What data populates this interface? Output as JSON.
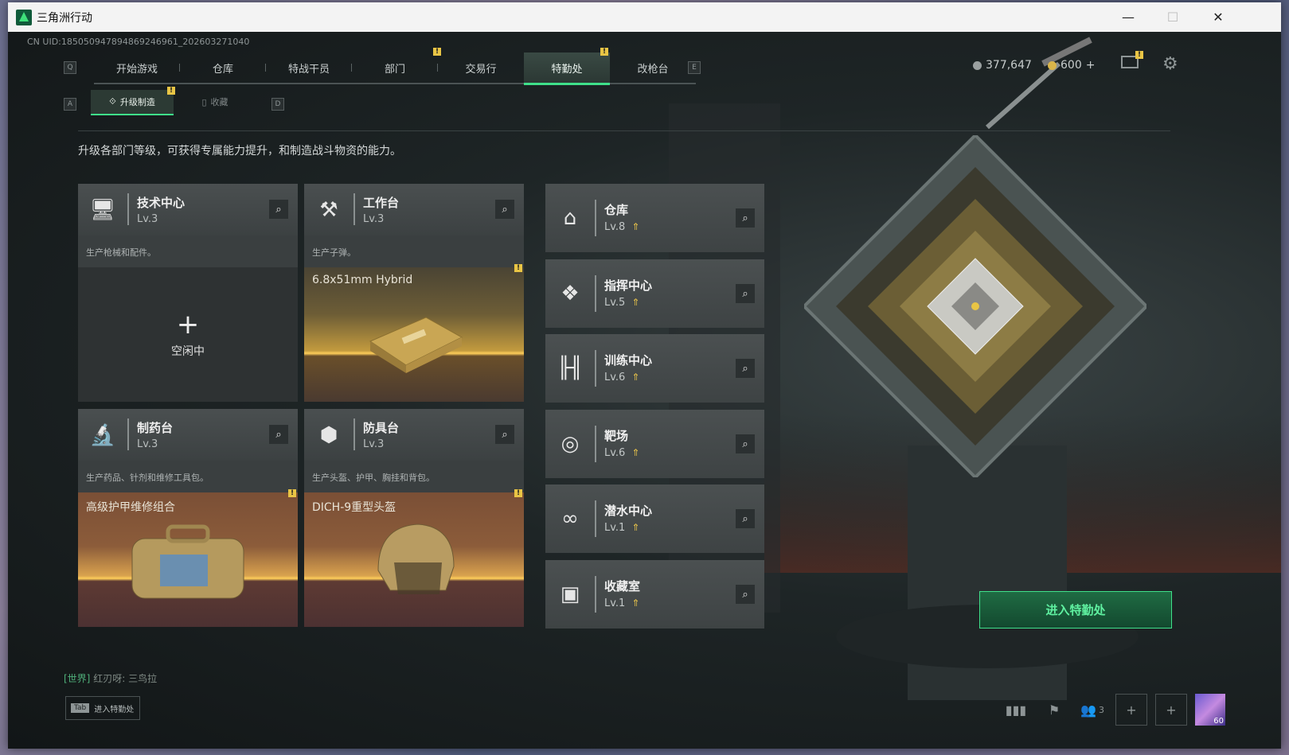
{
  "window": {
    "title": "三角洲行动",
    "minimize": "—",
    "maximize": "☐",
    "close": "✕"
  },
  "uid": "CN UID:1850509478948692469​61_202603271040",
  "nav": {
    "key_left": "Q",
    "key_right": "E",
    "tabs": [
      "开始游戏",
      "仓库",
      "特战干员",
      "部门",
      "交易行",
      "特勤处",
      "改枪台"
    ],
    "active": "特勤处",
    "badge": "!"
  },
  "currency": {
    "silver": "377,647",
    "gold": "600",
    "plus": "+"
  },
  "subnav": {
    "key_left": "A",
    "key_right": "D",
    "tabs": [
      "升级制造",
      "收藏"
    ],
    "active": "升级制造"
  },
  "description": "升级各部门等级，可获得专属能力提升，和制造战斗物资的能力。",
  "production_cards": [
    {
      "name": "技术中心",
      "level": "Lv.3",
      "subtitle": "生产枪械和配件。",
      "state": "idle",
      "idle_label": "空闲中",
      "plus": "+"
    },
    {
      "name": "工作台",
      "level": "Lv.3",
      "subtitle": "生产子弹。",
      "state": "producing",
      "product": "6.8x51mm Hybrid"
    },
    {
      "name": "制药台",
      "level": "Lv.3",
      "subtitle": "生产药品、针剂和维修工具包。",
      "state": "producing",
      "product": "高级护甲维修组合"
    },
    {
      "name": "防具台",
      "level": "Lv.3",
      "subtitle": "生产头盔、护甲、胸挂和背包。",
      "state": "producing",
      "product": "DICH-9重型头盔"
    }
  ],
  "departments": [
    {
      "name": "仓库",
      "level": "Lv.8"
    },
    {
      "name": "指挥中心",
      "level": "Lv.5"
    },
    {
      "name": "训练中心",
      "level": "Lv.6"
    },
    {
      "name": "靶场",
      "level": "Lv.6"
    },
    {
      "name": "潜水中心",
      "level": "Lv.1"
    },
    {
      "name": "收藏室",
      "level": "Lv.1"
    }
  ],
  "enter_button": "进入特勤处",
  "chat": {
    "channel": "[世界]",
    "user": "红刃呀",
    "message": "三鸟拉"
  },
  "tab_hint": {
    "key": "Tab",
    "label": "进入特勤处"
  },
  "bottom": {
    "team_count": "3",
    "avatar_level": "60"
  },
  "colors": {
    "accent": "#3fe08a",
    "badge": "#e9c545",
    "gold": "#ffcf5a"
  }
}
